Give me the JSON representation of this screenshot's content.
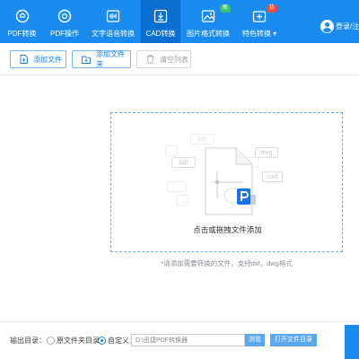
{
  "nav": {
    "items": [
      {
        "label": "PDF转换",
        "icon": "convert-cycle-icon"
      },
      {
        "label": "PDF操作",
        "icon": "settings-gear-icon"
      },
      {
        "label": "文字语音转换",
        "icon": "audio-wave-icon"
      },
      {
        "label": "CAD转换",
        "icon": "cad-download-icon",
        "active": true
      },
      {
        "label": "图片格式转换",
        "icon": "image-icon",
        "badge": "新"
      },
      {
        "label": "特色转换 ▾",
        "icon": "special-convert-icon",
        "badge": "热"
      }
    ],
    "login_label": "登录/注"
  },
  "toolbar": {
    "add_file_label": "添加文件",
    "add_folder_label": "添加文件夹",
    "clear_list_label": "清空列表"
  },
  "dropzone": {
    "hint": "点击或拖拽文件添加",
    "support_tip": "*请添加需要转换的文件，支持dxf，dwg格式",
    "deco_labels": [
      "pdf",
      "dwg",
      "cad"
    ]
  },
  "bottom": {
    "output_label": "输出目录：",
    "option_source_label": "原文件夹目录",
    "option_custom_label": "自定义：",
    "path_value": "D:\\迅捷PDF转换器",
    "browse_label": "浏览",
    "open_folder_label": "打开文件目录"
  },
  "colors": {
    "nav_bg": "#1a8cf0",
    "nav_active": "#0b6fd1",
    "accent": "#1a7ee0",
    "badge_new": "#3cc46b",
    "badge_hot": "#f04b3a",
    "pdf_logo": "#1a73e8"
  }
}
